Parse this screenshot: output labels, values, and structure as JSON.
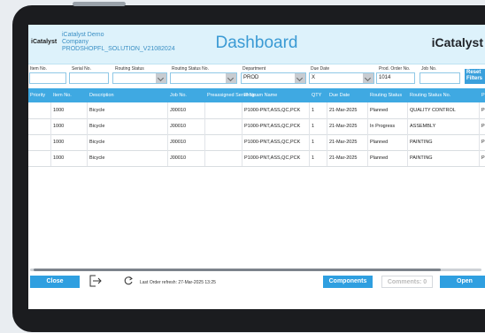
{
  "header": {
    "logo": "iCatalyst",
    "app_name": "iCatalyst Demo",
    "company": "Company",
    "solution": "PRODSHOPFL_SOLUTION_V21082024",
    "title": "Dashboard",
    "brand": "iCatalyst"
  },
  "filters": {
    "item_no": {
      "label": "Item No.",
      "value": ""
    },
    "serial_no": {
      "label": "Serial No.",
      "value": ""
    },
    "routing_status": {
      "label": "Routing Status",
      "value": ""
    },
    "routing_status_no": {
      "label": "Routing Status No.",
      "value": ""
    },
    "department": {
      "label": "Department",
      "value": "PROD"
    },
    "due_date": {
      "label": "Due Date",
      "value": "X"
    },
    "prod_order_no": {
      "label": "Prod. Order No.",
      "value": "1014"
    },
    "job_no": {
      "label": "Job No.",
      "value": ""
    },
    "reset_label": "Reset Filters"
  },
  "table": {
    "columns": [
      "Priority",
      "Item No.",
      "Description",
      "Job No.",
      "Preassigned Serial No.",
      "Program Name",
      "QTY",
      "Due Date",
      "Routing Status",
      "Routing Status No.",
      "P"
    ],
    "rows": [
      [
        "",
        "1000",
        "Bicycle",
        "J00010",
        "",
        "P1000-PNT,ASS,QC,PCK",
        "1",
        "21-Mar-2025",
        "Planned",
        "QUALITY CONTROL",
        "P"
      ],
      [
        "",
        "1000",
        "Bicycle",
        "J00010",
        "",
        "P1000-PNT,ASS,QC,PCK",
        "1",
        "21-Mar-2025",
        "In Progress",
        "ASSEMBLY",
        "P"
      ],
      [
        "",
        "1000",
        "Bicycle",
        "J00010",
        "",
        "P1000-PNT,ASS,QC,PCK",
        "1",
        "21-Mar-2025",
        "Planned",
        "PAINTING",
        "P"
      ],
      [
        "",
        "1000",
        "Bicycle",
        "J00010",
        "",
        "P1000-PNT,ASS,QC,PCK",
        "1",
        "21-Mar-2025",
        "Planned",
        "PAINTING",
        "P"
      ]
    ]
  },
  "footer": {
    "close_label": "Close",
    "refresh_text": "Last Order refresh: 27-Mar-2025 13:25",
    "components_label": "Components",
    "comments_label": "Comments: 0",
    "open_label": "Open"
  },
  "colors": {
    "accent": "#2f9fe0",
    "header_bg": "#ddf2fb",
    "table_header": "#3fa9e2"
  },
  "icons": [
    "logout-icon",
    "refresh-icon",
    "dropdown-arrow-icon"
  ]
}
